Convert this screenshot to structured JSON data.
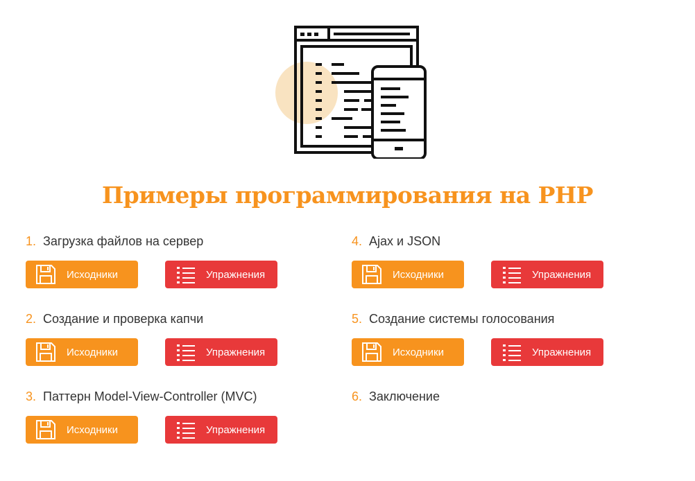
{
  "page": {
    "title": "Примеры программирования на PHP"
  },
  "colors": {
    "accent": "#f7931e",
    "secondary": "#e8393a",
    "text": "#333333"
  },
  "items": [
    {
      "num": "1.",
      "name": "Загрузка файлов на сервер",
      "sources_label": "Исходники",
      "exercises_label": "Упражнения"
    },
    {
      "num": "2.",
      "name": "Создание и проверка капчи",
      "sources_label": "Исходники",
      "exercises_label": "Упражнения"
    },
    {
      "num": "3.",
      "name": "Паттерн Model-View-Controller (MVC)",
      "sources_label": "Исходники",
      "exercises_label": "Упражнения"
    },
    {
      "num": "4.",
      "name": "Ajax и JSON",
      "sources_label": "Исходники",
      "exercises_label": "Упражнения"
    },
    {
      "num": "5.",
      "name": "Создание системы голосования",
      "sources_label": "Исходники",
      "exercises_label": "Упражнения"
    },
    {
      "num": "6.",
      "name": "Заключение"
    }
  ],
  "icons": {
    "hero": "code-window-mobile-icon",
    "sources": "floppy-disk-icon",
    "exercises": "list-icon"
  }
}
